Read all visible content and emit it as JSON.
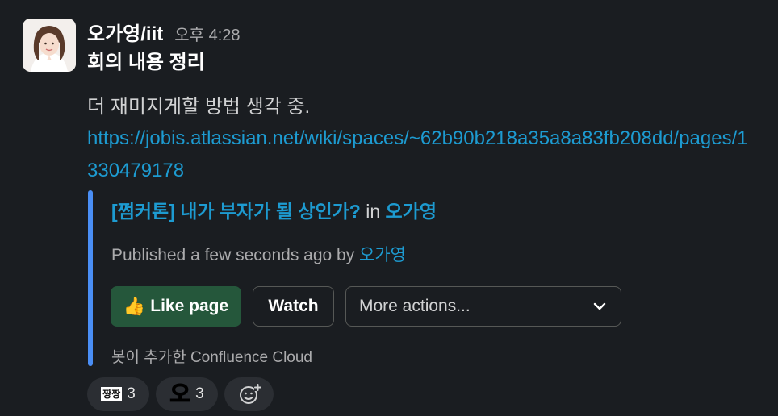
{
  "message": {
    "username": "오가영/iit",
    "time": "오후 4:28",
    "title": "회의 내용 정리",
    "body": "더 재미지게할 방법 생각 중.",
    "link": "https://jobis.atlassian.net/wiki/spaces/~62b90b218a35a8a83fb208dd/pages/1330479178"
  },
  "unfurl": {
    "page_title": "[쩜커톤] 내가 부자가 될 상인가?",
    "in_text": " in ",
    "space_name": "오가영",
    "meta_text": "Published a few seconds ago by ",
    "author": "오가영",
    "like_label": "Like page",
    "watch_label": "Watch",
    "more_label": "More actions...",
    "added_by": "봇이 추가한 Confluence Cloud",
    "accent_color": "#4a8ef5"
  },
  "reactions": [
    {
      "emoji": "짱짱",
      "count": "3"
    },
    {
      "emoji": "오",
      "count": "3"
    }
  ],
  "icons": {
    "thumb": "thumbs-up-icon",
    "chevron": "chevron-down-icon",
    "add_reaction": "add-reaction-icon"
  }
}
